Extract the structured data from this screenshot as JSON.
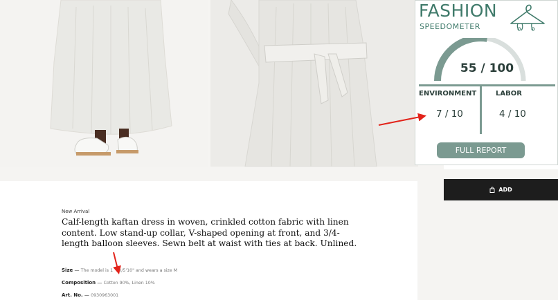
{
  "widget": {
    "title": "FASHION",
    "subtitle": "SPEEDOMETER",
    "score": "55 / 100",
    "score_fraction": 0.55,
    "environment_label": "ENVIRONMENT",
    "environment_value": "7 / 10",
    "labor_label": "LABOR",
    "labor_value": "4 / 10",
    "report_button": "FULL REPORT",
    "accent_color": "#7b9a91",
    "brand_color": "#3f7a6a",
    "icons": [
      "hanger-icon"
    ]
  },
  "product": {
    "badge": "New Arrival",
    "description": "Calf-length kaftan dress in woven, crinkled cotton fabric with linen content. Low stand-up collar, V-shaped opening at front, and 3/4-length balloon sleeves. Sewn belt at waist with ties at back. Unlined.",
    "specs": {
      "size_label": "Size",
      "size_value": "The model is 1   m/5'10\" and wears a size M",
      "composition_label": "Composition",
      "composition_value": "Cotton 90%, Linen 10%",
      "art_label": "Art. No.",
      "art_value": "0930963001"
    }
  },
  "cart": {
    "add_label": "ADD",
    "icons": [
      "shopping-bag-icon"
    ]
  },
  "annotations": {
    "arrow_color": "#e2231a"
  }
}
